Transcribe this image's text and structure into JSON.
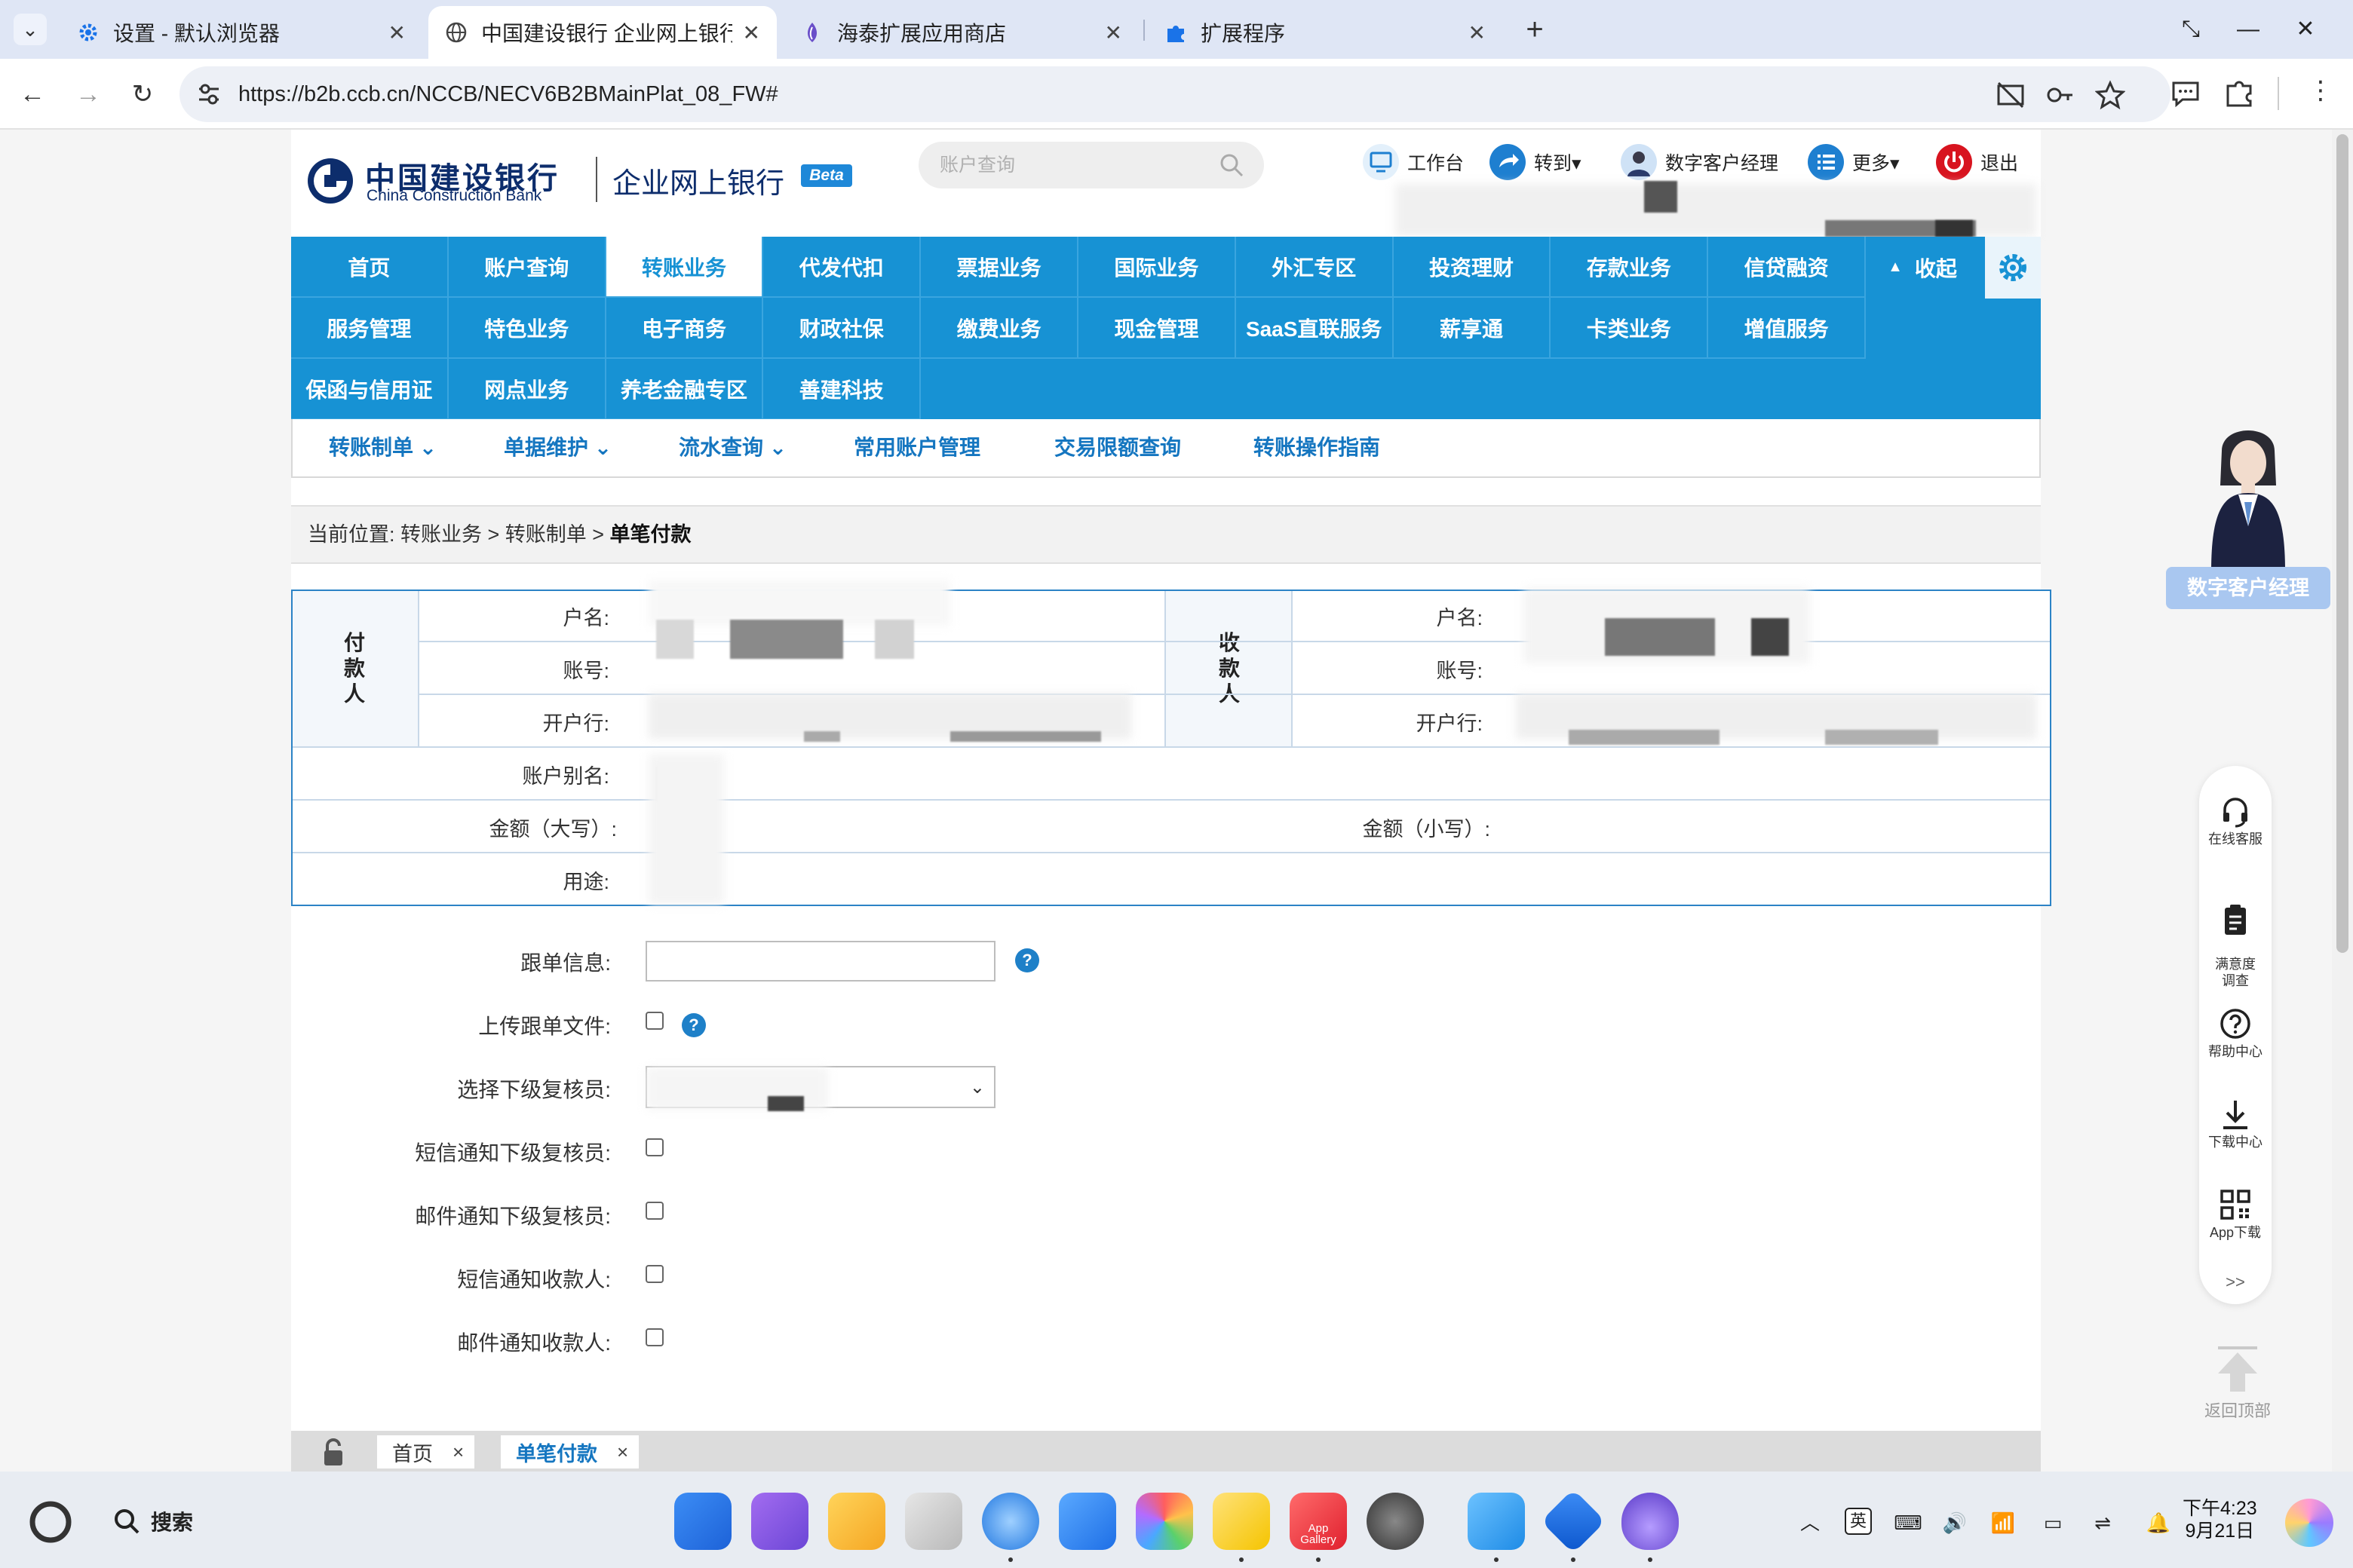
{
  "browser": {
    "tabs": [
      {
        "label": "设置 - 默认浏览器",
        "icon": "gear-icon",
        "active": false
      },
      {
        "label": "中国建设银行 企业网上银行",
        "icon": "globe-icon",
        "active": true
      },
      {
        "label": "海泰扩展应用商店",
        "icon": "store-icon",
        "active": false
      },
      {
        "label": "扩展程序",
        "icon": "puzzle-icon",
        "active": false
      }
    ],
    "new_tab": "+",
    "url": "https://b2b.ccb.cn/NCCB/NECV6B2BMainPlat_08_FW#",
    "colors": {
      "tabstrip": "#dfe6f5",
      "omnibox": "#edf0f6"
    }
  },
  "header": {
    "logo_cn": "中国建设银行",
    "logo_en": "China Construction Bank",
    "logo_sub": "企业网上银行",
    "beta": "Beta",
    "search_placeholder": "账户查询",
    "links": [
      {
        "label": "工作台",
        "icon": "monitor-icon"
      },
      {
        "label": "转到▾",
        "icon": "share-arrow-icon"
      },
      {
        "label": "数字客户经理",
        "icon": "avatar-icon"
      },
      {
        "label": "更多▾",
        "icon": "list-icon"
      },
      {
        "label": "退出",
        "icon": "power-icon"
      }
    ]
  },
  "main_nav": {
    "rows": [
      [
        "首页",
        "账户查询",
        "转账业务",
        "代发代扣",
        "票据业务",
        "国际业务",
        "外汇专区",
        "投资理财",
        "存款业务",
        "信贷融资"
      ],
      [
        "服务管理",
        "特色业务",
        "电子商务",
        "财政社保",
        "缴费业务",
        "现金管理",
        "SaaS直联服务",
        "薪享通",
        "卡类业务",
        "增值服务"
      ],
      [
        "保函与信用证",
        "网点业务",
        "养老金融专区",
        "善建科技"
      ]
    ],
    "active": "转账业务",
    "collapse_label": "收起",
    "accent": "#1792d4"
  },
  "sub_nav": [
    "转账制单 ⌄",
    "单据维护 ⌄",
    "流水查询 ⌄",
    "常用账户管理",
    "交易限额查询",
    "转账操作指南"
  ],
  "breadcrumb": {
    "prefix": "当前位置:  转账业务 > 转账制单 > ",
    "current": "单笔付款"
  },
  "transfer_form": {
    "payer_label": "付款人",
    "payee_label": "收款人",
    "name_label": "户名:",
    "account_label": "账号:",
    "bank_label": "开户行:",
    "alias_label": "账户别名:",
    "amount_upper_label": "金额（大写）:",
    "amount_lower_label": "金额（小写）:",
    "purpose_label": "用途:"
  },
  "options_form": {
    "follow_info_label": "跟单信息:",
    "upload_label": "上传跟单文件:",
    "reviewer_label": "选择下级复核员:",
    "sms_reviewer_label": "短信通知下级复核员:",
    "email_reviewer_label": "邮件通知下级复核员:",
    "sms_payee_label": "短信通知收款人:",
    "email_payee_label": "邮件通知收款人:"
  },
  "page_tabs": [
    {
      "label": "首页",
      "close": "×"
    },
    {
      "label": "单笔付款",
      "close": "×",
      "active": true
    }
  ],
  "side_widgets": {
    "assistant_badge": "数字客户经理",
    "items": [
      {
        "label": "在线客服",
        "icon": "headset-icon"
      },
      {
        "label": "满意度\n调查",
        "icon": "clipboard-icon"
      },
      {
        "label": "帮助中心",
        "icon": "question-circle-icon"
      },
      {
        "label": "下载中心",
        "icon": "download-icon"
      },
      {
        "label": "App下载",
        "icon": "qrcode-icon"
      }
    ],
    "expand": ">>",
    "back_to_top": "返回顶部"
  },
  "taskbar": {
    "search_label": "搜索",
    "time": "下午4:23",
    "date": "9月21日",
    "ime": "英",
    "app_gallery_label": "App Gallery"
  }
}
